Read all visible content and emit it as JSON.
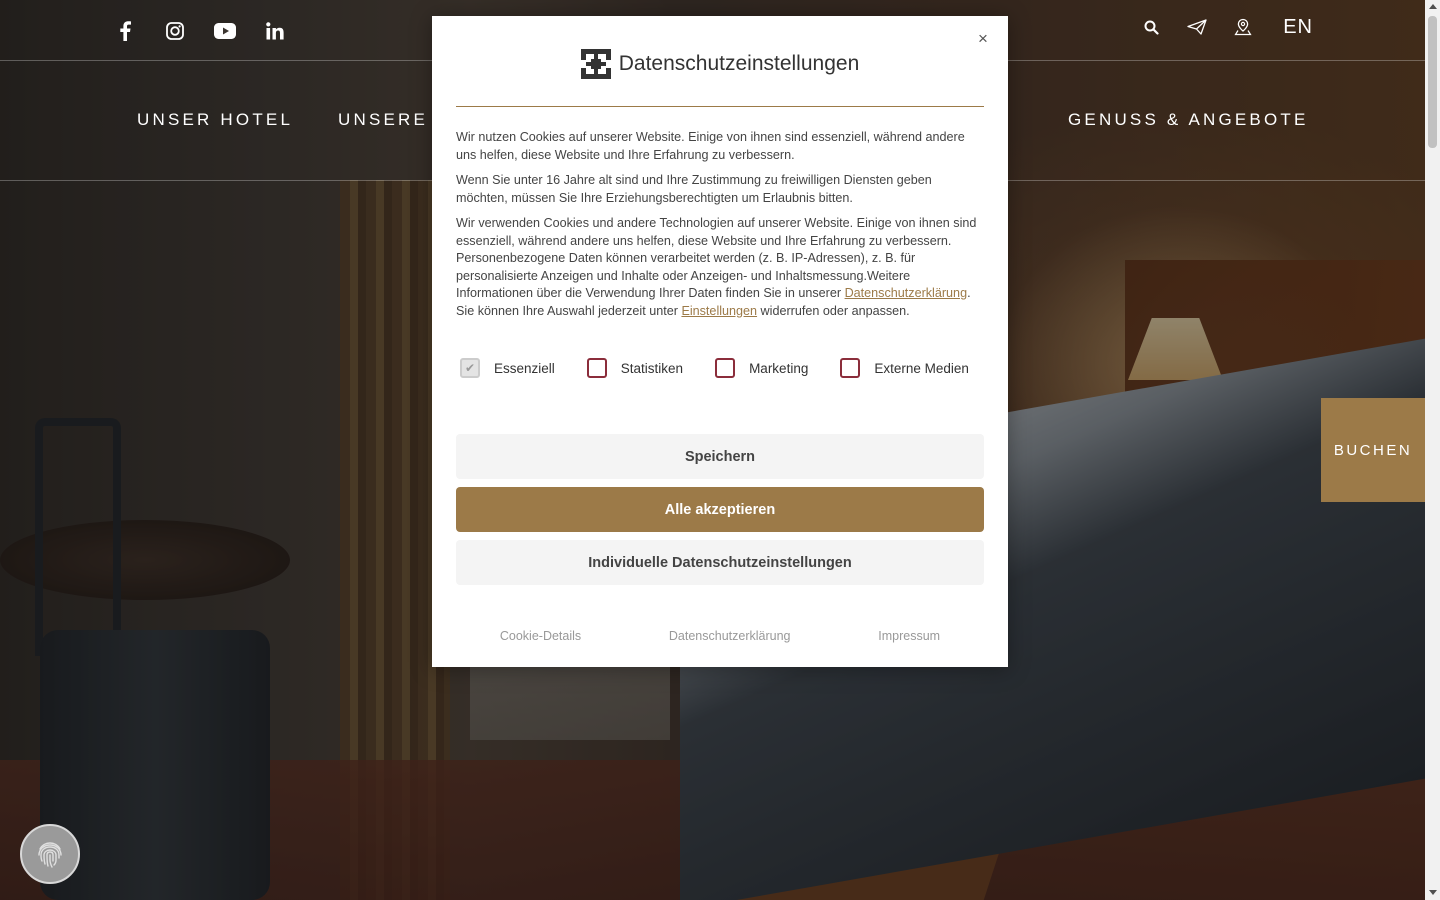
{
  "header": {
    "social": [
      {
        "name": "facebook-icon"
      },
      {
        "name": "instagram-icon"
      },
      {
        "name": "youtube-icon"
      },
      {
        "name": "linkedin-icon"
      }
    ],
    "tools": [
      "search-icon",
      "paper-plane-icon",
      "location-pin-icon"
    ],
    "language": "EN"
  },
  "nav": {
    "items": [
      "UNSER HOTEL",
      "UNSERE Z",
      "GENUSS & ANGEBOTE"
    ]
  },
  "book_button": "BUCHEN",
  "modal": {
    "title": "Datenschutzeinstellungen",
    "close_label": "×",
    "paragraph1": "Wir nutzen Cookies auf unserer Website. Einige von ihnen sind essenziell, während andere uns helfen, diese Website und Ihre Erfahrung zu verbessern.",
    "paragraph2": "Wenn Sie unter 16 Jahre alt sind und Ihre Zustimmung zu freiwilligen Diensten geben möchten, müssen Sie Ihre Erziehungsberechtigten um Erlaubnis bitten.",
    "paragraph3_part1": "Wir verwenden Cookies und andere Technologien auf unserer Website. Einige von ihnen sind essenziell, während andere uns helfen, diese Website und Ihre Erfahrung zu verbessern. Personenbezogene Daten können verarbeitet werden (z. B. IP-Adressen), z. B. für personalisierte Anzeigen und Inhalte oder Anzeigen- und Inhaltsmessung.Weitere Informationen über die Verwendung Ihrer Daten finden Sie in unserer ",
    "privacy_link": "Datenschutzerklärung",
    "paragraph3_part2": ". Sie können Ihre Auswahl jederzeit unter ",
    "settings_link": "Einstellungen",
    "paragraph3_part3": " widerrufen oder anpassen.",
    "checkboxes": [
      {
        "label": "Essenziell",
        "checked": true,
        "disabled": true
      },
      {
        "label": "Statistiken",
        "checked": false,
        "disabled": false
      },
      {
        "label": "Marketing",
        "checked": false,
        "disabled": false
      },
      {
        "label": "Externe Medien",
        "checked": false,
        "disabled": false
      }
    ],
    "save_label": "Speichern",
    "accept_all_label": "Alle akzeptieren",
    "individual_label": "Individuelle Datenschutzeinstellungen",
    "footer_links": [
      "Cookie-Details",
      "Datenschutzerklärung",
      "Impressum"
    ]
  },
  "colors": {
    "accent": "#9c7a48",
    "checkbox_border": "#8b2d3b"
  }
}
